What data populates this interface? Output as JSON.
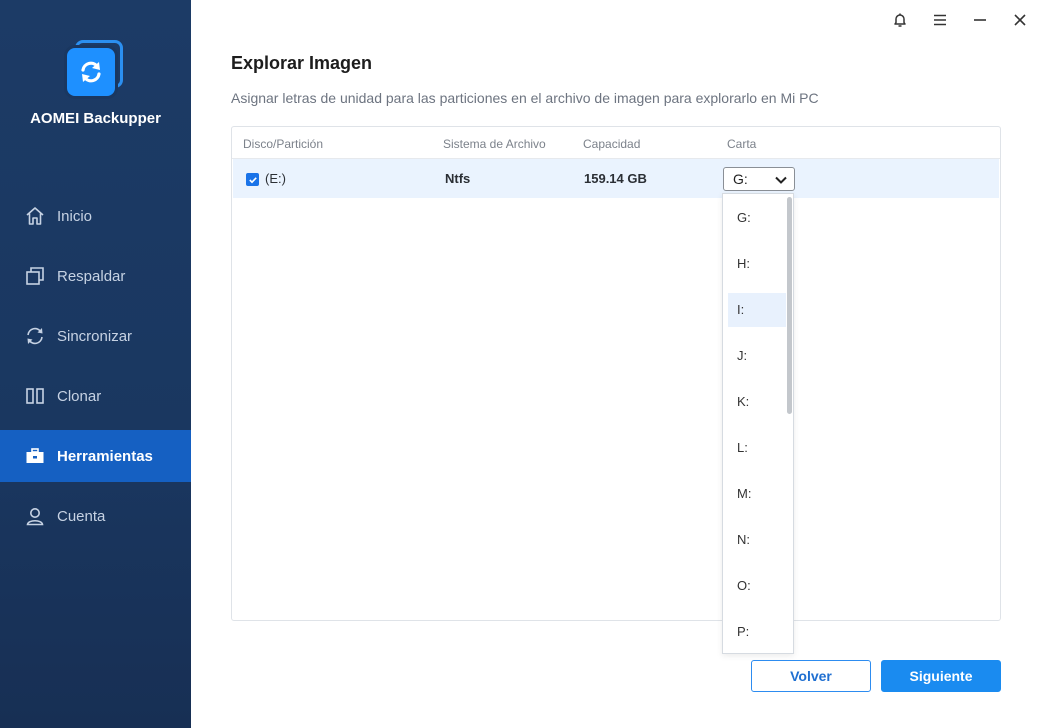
{
  "app": {
    "name": "AOMEI Backupper"
  },
  "colors": {
    "sidebar": "#1c3b66",
    "active_nav": "#1560c2",
    "accent": "#1a8bf0",
    "row_highlight": "#eaf3fe"
  },
  "nav": {
    "items": [
      {
        "label": "Inicio",
        "icon": "home-icon",
        "active": false
      },
      {
        "label": "Respaldar",
        "icon": "backup-icon",
        "active": false
      },
      {
        "label": "Sincronizar",
        "icon": "sync-icon",
        "active": false
      },
      {
        "label": "Clonar",
        "icon": "clone-icon",
        "active": false
      },
      {
        "label": "Herramientas",
        "icon": "toolbox-icon",
        "active": true
      },
      {
        "label": "Cuenta",
        "icon": "user-icon",
        "active": false
      }
    ]
  },
  "window_controls": [
    "bell-icon",
    "menu-icon",
    "minimize-icon",
    "close-icon"
  ],
  "page": {
    "title": "Explorar Imagen",
    "subtitle": "Asignar letras de unidad para las particiones en el archivo de imagen para explorarlo en Mi PC"
  },
  "table": {
    "headers": [
      "Disco/Partición",
      "Sistema de Archivo",
      "Capacidad",
      "Carta"
    ],
    "rows": [
      {
        "checked": true,
        "partition": "(E:)",
        "filesystem": "Ntfs",
        "capacity": "159.14 GB",
        "letter": "G:"
      }
    ]
  },
  "letter_dropdown": {
    "selected": "G:",
    "highlighted": "I:",
    "options": [
      "G:",
      "H:",
      "I:",
      "J:",
      "K:",
      "L:",
      "M:",
      "N:",
      "O:",
      "P:"
    ]
  },
  "buttons": {
    "back": "Volver",
    "next": "Siguiente"
  }
}
